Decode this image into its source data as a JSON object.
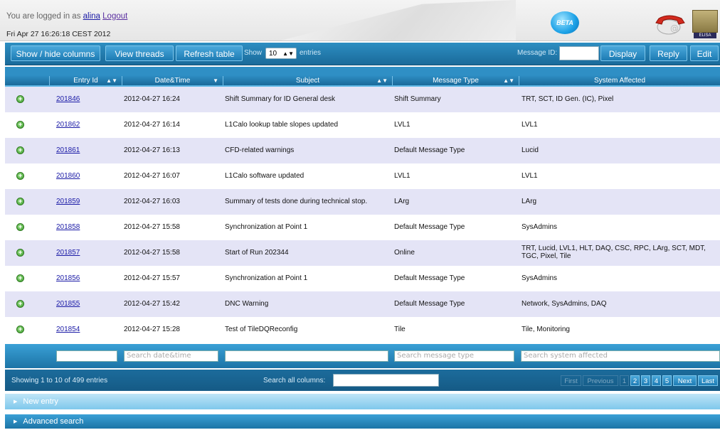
{
  "header": {
    "login_prefix": "You are logged in as ",
    "username": "alina",
    "logout_label": "Logout",
    "date": "Fri Apr 27 16:26:18 CEST 2012",
    "beta_badge": "BETA",
    "logo_text": "ELISA"
  },
  "toolbar": {
    "show_hide_columns": "Show / hide columns",
    "view_threads": "View threads",
    "refresh_table": "Refresh table",
    "show_label": "Show",
    "show_value": "10",
    "entries_label": "entries",
    "message_id_label": "Message ID:",
    "display": "Display",
    "reply": "Reply",
    "edit": "Edit"
  },
  "table": {
    "columns": [
      "Entry Id",
      "Date&Time",
      "Subject",
      "Message Type",
      "System Affected"
    ],
    "rows": [
      {
        "id": "201846",
        "datetime": "2012-04-27 16:24",
        "subject": "Shift Summary for ID General desk",
        "type": "Shift Summary",
        "system": "TRT, SCT, ID Gen. (IC), Pixel"
      },
      {
        "id": "201862",
        "datetime": "2012-04-27 16:14",
        "subject": "L1Calo lookup table slopes updated",
        "type": "LVL1",
        "system": "LVL1"
      },
      {
        "id": "201861",
        "datetime": "2012-04-27 16:13",
        "subject": "CFD-related warnings",
        "type": "Default Message Type",
        "system": "Lucid"
      },
      {
        "id": "201860",
        "datetime": "2012-04-27 16:07",
        "subject": "L1Calo software updated",
        "type": "LVL1",
        "system": "LVL1"
      },
      {
        "id": "201859",
        "datetime": "2012-04-27 16:03",
        "subject": "Summary of tests done during technical stop.",
        "type": "LArg",
        "system": "LArg"
      },
      {
        "id": "201858",
        "datetime": "2012-04-27 15:58",
        "subject": "Synchronization at Point 1",
        "type": "Default Message Type",
        "system": "SysAdmins"
      },
      {
        "id": "201857",
        "datetime": "2012-04-27 15:58",
        "subject": "Start of Run 202344",
        "type": "Online",
        "system": "TRT, Lucid, LVL1, HLT, DAQ, CSC, RPC, LArg, SCT, MDT, TGC, Pixel, Tile"
      },
      {
        "id": "201856",
        "datetime": "2012-04-27 15:57",
        "subject": "Synchronization at Point 1",
        "type": "Default Message Type",
        "system": "SysAdmins"
      },
      {
        "id": "201855",
        "datetime": "2012-04-27 15:42",
        "subject": "DNC Warning",
        "type": "Default Message Type",
        "system": "Network, SysAdmins, DAQ"
      },
      {
        "id": "201854",
        "datetime": "2012-04-27 15:28",
        "subject": "Test of TileDQReconfig",
        "type": "Tile",
        "system": "Tile, Monitoring"
      }
    ],
    "filters": {
      "entry_id": "",
      "datetime": "Search date&time",
      "subject": "",
      "type": "Search message type",
      "system": "Search system affected"
    }
  },
  "footer": {
    "showing": "Showing 1 to 10 of 499 entries",
    "search_all_label": "Search all columns:",
    "pager": [
      "First",
      "Previous",
      "1",
      "2",
      "3",
      "4",
      "5",
      "Next",
      "Last"
    ]
  },
  "panels": {
    "new_entry": "New entry",
    "advanced_search": "Advanced search"
  }
}
